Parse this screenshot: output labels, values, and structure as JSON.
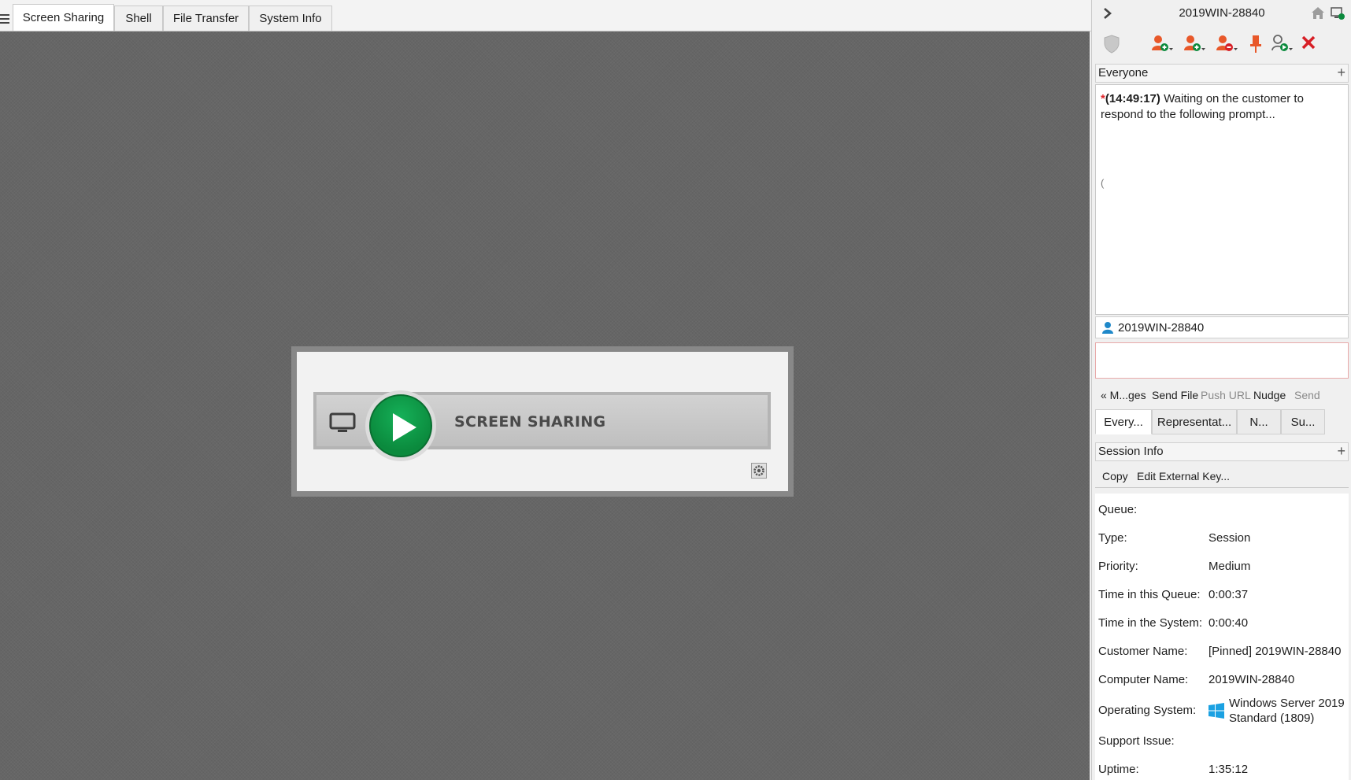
{
  "tabs": [
    {
      "label": "Screen Sharing",
      "active": true
    },
    {
      "label": "Shell",
      "active": false
    },
    {
      "label": "File Transfer",
      "active": false
    },
    {
      "label": "System Info",
      "active": false
    }
  ],
  "screen_sharing": {
    "label": "SCREEN SHARING",
    "icons": [
      "monitor-icon",
      "play-icon",
      "settings-gear-icon"
    ],
    "play_color": "#0b8a3d"
  },
  "right_panel": {
    "title": "2019WIN-28840",
    "header_icons": [
      "chevron-right-icon",
      "home-icon",
      "screen-share-icon"
    ],
    "toolbar_icons": [
      "shield-icon",
      "add-user-icon",
      "invite-user-icon",
      "remove-user-icon",
      "pin-icon",
      "transfer-icon",
      "close-session-icon"
    ],
    "close_color": "#d71f26",
    "accent_orange": "#e8582a"
  },
  "chat": {
    "section_title": "Everyone",
    "messages": [
      {
        "marker": "*",
        "time": "(14:49:17)",
        "text": "Waiting on the customer to respond to the following prompt..."
      }
    ],
    "cursor_glyph": "(",
    "recipient": "2019WIN-28840",
    "input_value": "",
    "actions": {
      "messages": "« M...ges",
      "send_file": "Send File",
      "push_url": "Push URL",
      "nudge": "Nudge",
      "send": "Send"
    },
    "tabs": [
      {
        "label": "Every...",
        "active": true
      },
      {
        "label": "Representat...",
        "active": false
      },
      {
        "label": "N...",
        "active": false
      },
      {
        "label": "Su...",
        "active": false
      }
    ]
  },
  "session_info": {
    "section_title": "Session Info",
    "actions": {
      "copy": "Copy",
      "edit_key": "Edit External Key..."
    },
    "rows": [
      {
        "key": "Queue:",
        "value": ""
      },
      {
        "key": "Type:",
        "value": "Session"
      },
      {
        "key": "Priority:",
        "value": "Medium"
      },
      {
        "key": "Time in this Queue:",
        "value": "0:00:37"
      },
      {
        "key": "Time in the System:",
        "value": "0:00:40"
      },
      {
        "key": "Customer Name:",
        "value": "[Pinned] 2019WIN-28840"
      },
      {
        "key": "Computer Name:",
        "value": "2019WIN-28840"
      },
      {
        "key": "Operating System:",
        "value_line1": "Windows Server 2019",
        "value_line2": "Standard (1809)"
      },
      {
        "key": "Support Issue:",
        "value": ""
      },
      {
        "key": "Uptime:",
        "value": "1:35:12"
      }
    ]
  }
}
